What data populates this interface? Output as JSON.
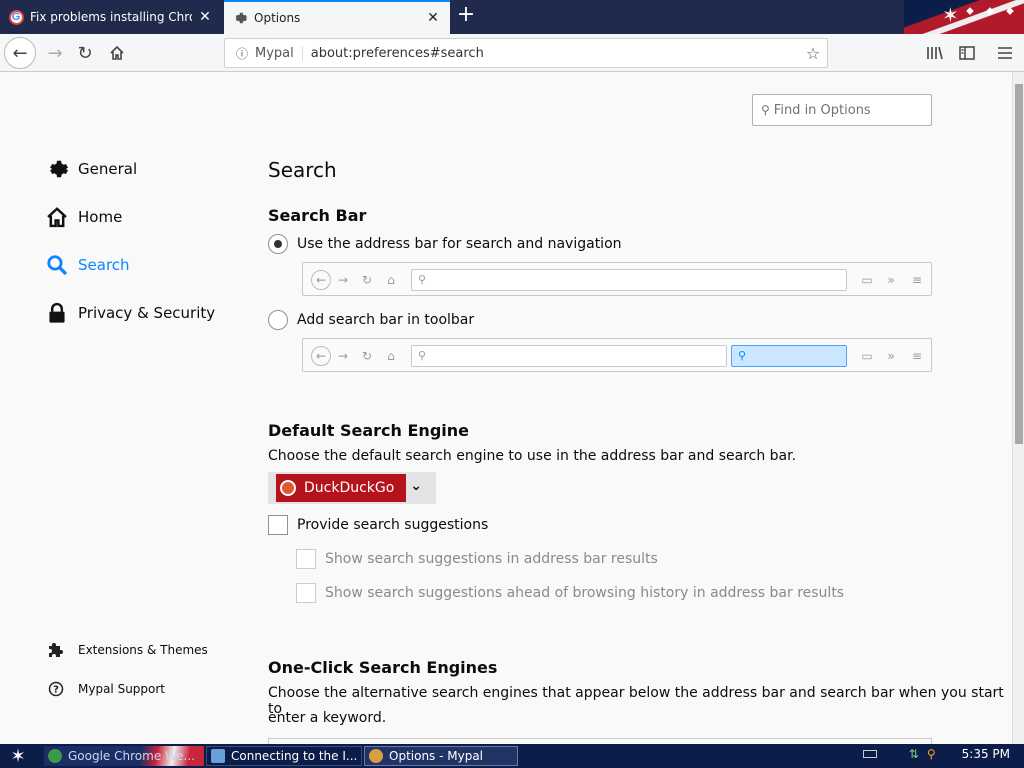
{
  "tabs": [
    {
      "title": "Fix problems installing Chrome - Go",
      "icon": "google-icon",
      "active": false
    },
    {
      "title": "Options",
      "icon": "gear-icon",
      "active": true
    }
  ],
  "navbar": {
    "site_name": "Mypal",
    "url": "about:preferences#search"
  },
  "find": {
    "placeholder": "Find in Options"
  },
  "sidebar": {
    "items": [
      {
        "label": "General",
        "icon": "gear-icon"
      },
      {
        "label": "Home",
        "icon": "home-icon"
      },
      {
        "label": "Search",
        "icon": "search-icon",
        "selected": true
      },
      {
        "label": "Privacy & Security",
        "icon": "lock-icon"
      }
    ],
    "footer": [
      {
        "label": "Extensions & Themes",
        "icon": "puzzle-icon"
      },
      {
        "label": "Mypal Support",
        "icon": "help-icon"
      }
    ]
  },
  "main": {
    "title": "Search",
    "search_bar": {
      "heading": "Search Bar",
      "option_address": "Use the address bar for search and navigation",
      "option_toolbar": "Add search bar in toolbar",
      "selected": "option_address"
    },
    "default_engine": {
      "heading": "Default Search Engine",
      "description": "Choose the default search engine to use in the address bar and search bar.",
      "engine": "DuckDuckGo",
      "suggestions": "Provide search suggestions",
      "suggest_address": "Show search suggestions in address bar results",
      "suggest_ahead": "Show search suggestions ahead of browsing history in address bar results"
    },
    "one_click": {
      "heading": "One-Click Search Engines",
      "description_1": "Choose the alternative search engines that appear below the address bar and search bar when you start to",
      "description_2": "enter a keyword."
    }
  },
  "taskbar": {
    "items": [
      "Google Chrome We...",
      "Connecting to the I...",
      "Options - Mypal"
    ],
    "clock": "5:35 PM"
  },
  "colors": {
    "accent": "#0a84ff",
    "engine_bg": "#b5121b",
    "taskbar": "#0d1d4a"
  }
}
